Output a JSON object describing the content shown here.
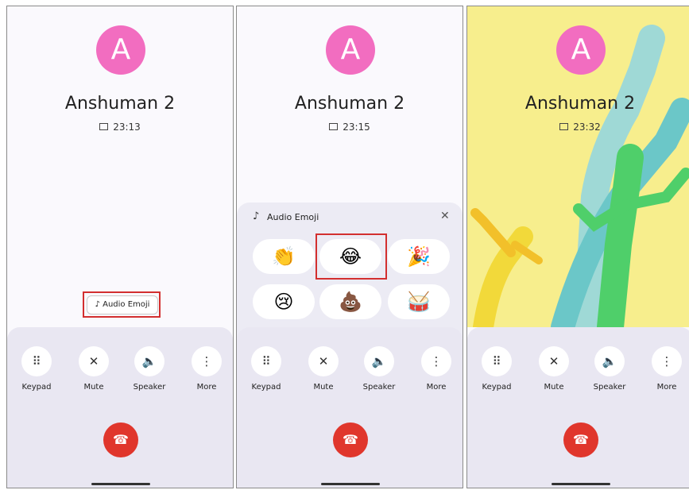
{
  "panels": [
    {
      "avatar_letter": "A",
      "name": "Anshuman 2",
      "time": "23:13",
      "chip_label": "Audio Emoji"
    },
    {
      "avatar_letter": "A",
      "name": "Anshuman 2",
      "time": "23:15",
      "sheet": {
        "title": "Audio Emoji",
        "close_icon": "close-icon",
        "emojis": [
          "👏",
          "😂",
          "🎉",
          "😢",
          "💩",
          "🥁"
        ]
      }
    },
    {
      "avatar_letter": "A",
      "name": "Anshuman 2",
      "time": "23:32"
    }
  ],
  "controls": {
    "keypad": "Keypad",
    "mute": "Mute",
    "speaker": "Speaker",
    "more": "More"
  },
  "icons": {
    "keypad": "⠿",
    "mute": "✕",
    "speaker": "🔈",
    "more": "⋮",
    "end_call": "☎",
    "note": "♪"
  },
  "colors": {
    "avatar": "#f26dc0",
    "end_call": "#e0362c",
    "highlight": "#d32f2f",
    "celebration_bg": "#f7ee8d"
  }
}
